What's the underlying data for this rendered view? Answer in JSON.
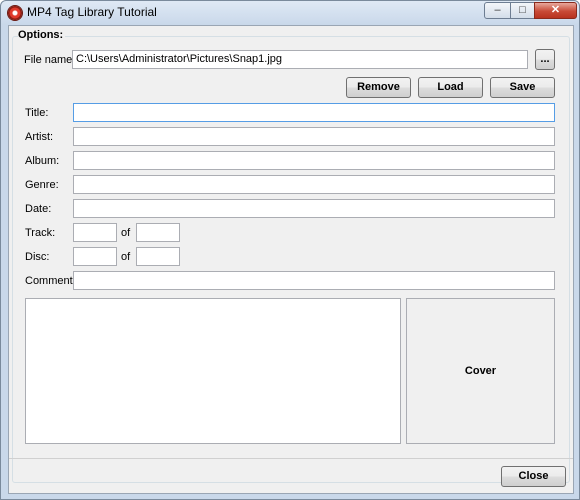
{
  "window": {
    "title": "MP4 Tag Library Tutorial",
    "controls": {
      "minimize": "–",
      "maximize": "□",
      "close": "✕"
    }
  },
  "options": {
    "group_label": "Options:",
    "file_name_label": "File name:",
    "file_name_value": "C:\\Users\\Administrator\\Pictures\\Snap1.jpg",
    "browse_label": "...",
    "remove_label": "Remove",
    "load_label": "Load",
    "save_label": "Save"
  },
  "fields": {
    "title_label": "Title:",
    "title_value": "",
    "artist_label": "Artist:",
    "artist_value": "",
    "album_label": "Album:",
    "album_value": "",
    "genre_label": "Genre:",
    "genre_value": "",
    "date_label": "Date:",
    "date_value": "",
    "track_label": "Track:",
    "track_value": "",
    "track_of_label": "of",
    "track_total_value": "",
    "disc_label": "Disc:",
    "disc_value": "",
    "disc_of_label": "of",
    "disc_total_value": "",
    "comment_label": "Comment:",
    "comment_value": ""
  },
  "cover": {
    "label": "Cover"
  },
  "footer": {
    "close_label": "Close"
  }
}
